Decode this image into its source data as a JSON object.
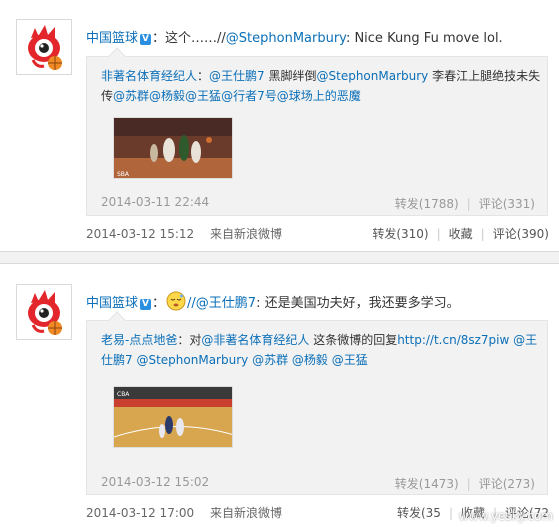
{
  "posts": [
    {
      "author": "中国篮球",
      "verified_badge": "V",
      "text_prefix": "：这个……//",
      "mention": "@StephonMarbury",
      "text_suffix": ": Nice Kung Fu move lol.",
      "quote": {
        "author": "非著名体育经纪人",
        "body_parts": [
          {
            "text": "非著名体育经纪人",
            "link": true
          },
          {
            "text": "：",
            "link": false
          },
          {
            "text": "@王仕鹏7",
            "link": true
          },
          {
            "text": " 黑脚绊倒",
            "link": false
          },
          {
            "text": "@StephonMarbury",
            "link": true
          },
          {
            "text": " 李春江上腿绝技未失传",
            "link": false
          },
          {
            "text": "@苏群",
            "link": true
          },
          {
            "text": "@杨毅",
            "link": true
          },
          {
            "text": "@王猛",
            "link": true
          },
          {
            "text": "@行者7号",
            "link": true
          },
          {
            "text": "@球场上的恶魔",
            "link": true
          }
        ],
        "time": "2014-03-11 22:44",
        "repost": "转发(1788)",
        "comment": "评论(331)"
      },
      "time": "2014-03-12 15:12",
      "source": "来自新浪微博",
      "actions": {
        "repost": "转发(310)",
        "favorite": "收藏",
        "comment": "评论(390)"
      }
    },
    {
      "author": "中国篮球",
      "verified_badge": "V",
      "text_prefix": "：",
      "emoji": "sleepy-face",
      "mention": "//@王仕鹏7",
      "text_suffix": ": 还是美国功夫好，我还要多学习。",
      "quote": {
        "body_parts": [
          {
            "text": "老易-点点地爸",
            "link": true
          },
          {
            "text": "：对",
            "link": false
          },
          {
            "text": "@非著名体育经纪人",
            "link": true
          },
          {
            "text": " 这条微博的回复",
            "link": false
          },
          {
            "text": "http://t.cn/8sz7piw",
            "link": true
          },
          {
            "text": " ",
            "link": false
          },
          {
            "text": "@王仕鹏7",
            "link": true
          },
          {
            "text": " ",
            "link": false
          },
          {
            "text": "@StephonMarbury",
            "link": true
          },
          {
            "text": " ",
            "link": false
          },
          {
            "text": "@苏群",
            "link": true
          },
          {
            "text": " ",
            "link": false
          },
          {
            "text": "@杨毅",
            "link": true
          },
          {
            "text": " ",
            "link": false
          },
          {
            "text": "@王猛",
            "link": true
          }
        ],
        "time": "2014-03-12 15:02",
        "repost": "转发(1473)",
        "comment": "评论(273)"
      },
      "time": "2014-03-12 17:00",
      "source": "来自新浪微博",
      "actions": {
        "repost": "转发(35",
        "favorite": "收藏",
        "comment": "评论(72"
      }
    }
  ],
  "watermark": "www.yesky.com",
  "colors": {
    "link": "#0b6fb8",
    "quote_bg": "#f2f2f2",
    "meta": "#999999"
  }
}
